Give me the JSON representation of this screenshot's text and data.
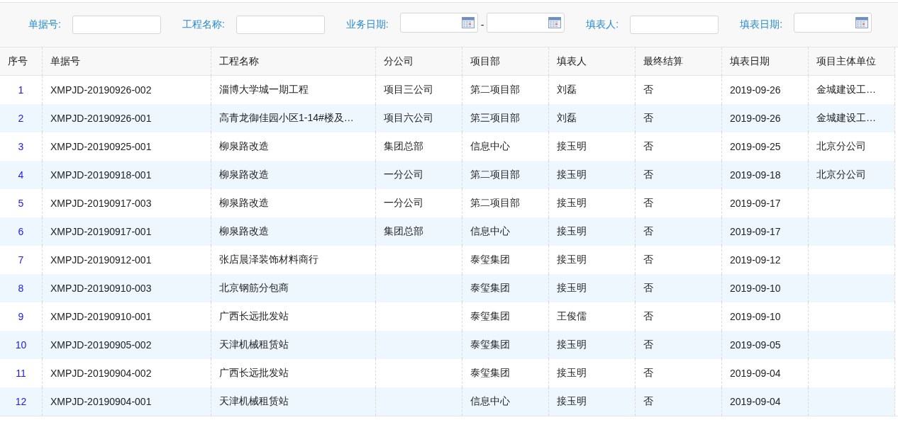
{
  "filters": [
    {
      "kind": "text",
      "label": "单据号:"
    },
    {
      "kind": "text",
      "label": "工程名称:"
    },
    {
      "kind": "daterange",
      "label": "业务日期:",
      "separator": "-"
    },
    {
      "kind": "text",
      "label": "填表人:"
    },
    {
      "kind": "date",
      "label": "填表日期:"
    }
  ],
  "table": {
    "columns": [
      "序号",
      "单据号",
      "工程名称",
      "分公司",
      "项目部",
      "填表人",
      "最终结算",
      "填表日期",
      "项目主体单位"
    ],
    "rows": [
      [
        "1",
        "XMPJD-20190926-002",
        "淄博大学城一期工程",
        "项目三公司",
        "第二项目部",
        "刘磊",
        "否",
        "2019-09-26",
        "金城建设工…"
      ],
      [
        "2",
        "XMPJD-20190926-001",
        "高青龙御佳园小区1-14#楼及…",
        "项目六公司",
        "第三项目部",
        "刘磊",
        "否",
        "2019-09-26",
        "金城建设工…"
      ],
      [
        "3",
        "XMPJD-20190925-001",
        "柳泉路改造",
        "集团总部",
        "信息中心",
        "接玉明",
        "否",
        "2019-09-25",
        "北京分公司"
      ],
      [
        "4",
        "XMPJD-20190918-001",
        "柳泉路改造",
        "一分公司",
        "第二项目部",
        "接玉明",
        "否",
        "2019-09-18",
        "北京分公司"
      ],
      [
        "5",
        "XMPJD-20190917-003",
        "柳泉路改造",
        "一分公司",
        "第二项目部",
        "接玉明",
        "否",
        "2019-09-17",
        ""
      ],
      [
        "6",
        "XMPJD-20190917-001",
        "柳泉路改造",
        "集团总部",
        "信息中心",
        "接玉明",
        "否",
        "2019-09-17",
        ""
      ],
      [
        "7",
        "XMPJD-20190912-001",
        "张店晨泽装饰材料商行",
        "",
        "泰玺集团",
        "接玉明",
        "否",
        "2019-09-12",
        ""
      ],
      [
        "8",
        "XMPJD-20190910-003",
        "北京钢筋分包商",
        "",
        "泰玺集团",
        "接玉明",
        "否",
        "2019-09-10",
        ""
      ],
      [
        "9",
        "XMPJD-20190910-001",
        "广西长远批发站",
        "",
        "泰玺集团",
        "王俊儒",
        "否",
        "2019-09-10",
        ""
      ],
      [
        "10",
        "XMPJD-20190905-002",
        "天津机械租赁站",
        "",
        "泰玺集团",
        "接玉明",
        "否",
        "2019-09-05",
        ""
      ],
      [
        "11",
        "XMPJD-20190904-002",
        "广西长远批发站",
        "",
        "泰玺集团",
        "接玉明",
        "否",
        "2019-09-04",
        ""
      ],
      [
        "12",
        "XMPJD-20190904-001",
        "天津机械租赁站",
        "",
        "信息中心",
        "接玉明",
        "否",
        "2019-09-04",
        ""
      ]
    ]
  }
}
